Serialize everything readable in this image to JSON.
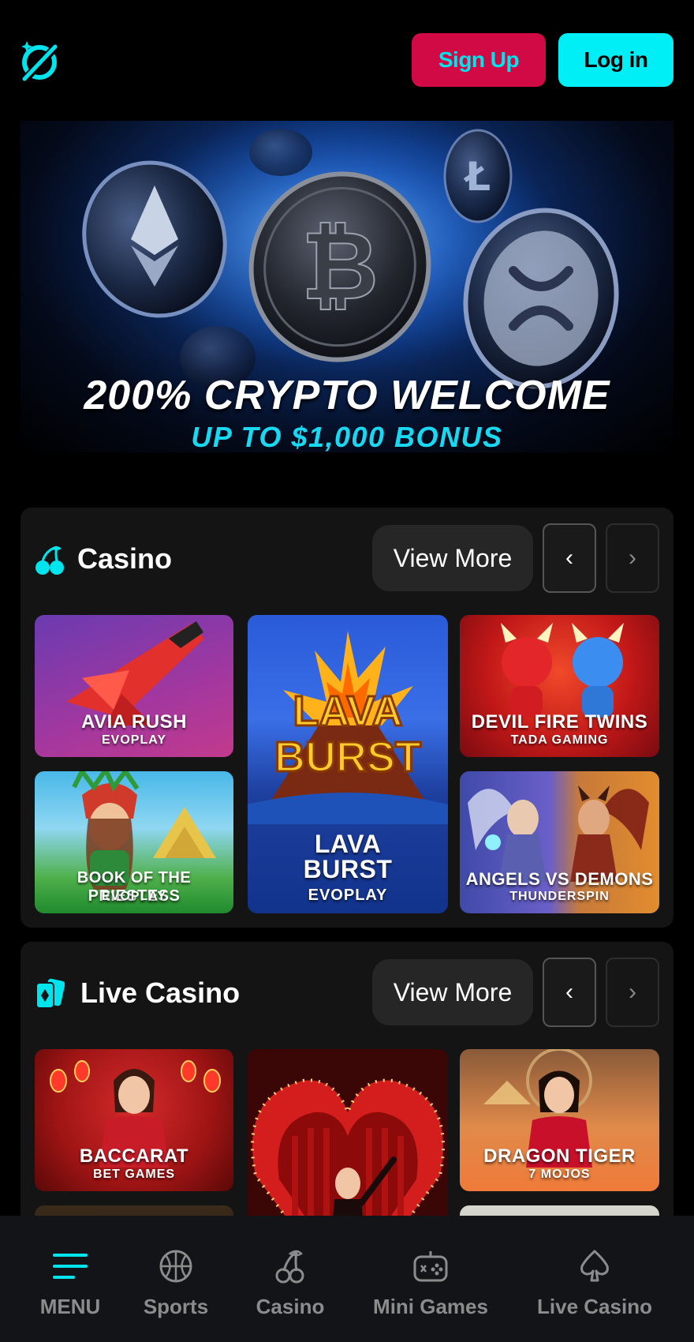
{
  "header": {
    "signup_label": "Sign Up",
    "login_label": "Log in"
  },
  "banner": {
    "line1": "200% CRYPTO WELCOME",
    "line2": "UP TO $1,000 BONUS"
  },
  "casino": {
    "title": "Casino",
    "view_more": "View More",
    "games": [
      {
        "name": "AVIA RUSH",
        "provider": "EVOPLAY"
      },
      {
        "name": "LAVA BURST",
        "name_line1": "LAVA",
        "name_line2": "BURST",
        "provider": "EVOPLAY",
        "logo_line1": "LAVA",
        "logo_line2": "BURST"
      },
      {
        "name": "DEVIL FIRE TWINS",
        "provider": "TADA GAMING"
      },
      {
        "name": "BOOK OF THE PRIESTESS",
        "provider": "EVOPLAY"
      },
      {
        "name": "ANGELS VS DEMONS",
        "provider": "THUNDERSPIN"
      }
    ]
  },
  "live_casino": {
    "title": "Live Casino",
    "view_more": "View More",
    "games": [
      {
        "name": "BACCARAT",
        "provider": "BET GAMES"
      },
      {
        "name": "",
        "provider": ""
      },
      {
        "name": "DRAGON TIGER",
        "provider": "7 MOJOS"
      }
    ]
  },
  "bottom_nav": {
    "items": [
      {
        "label": "MENU",
        "icon": "menu-icon",
        "active": true
      },
      {
        "label": "Sports",
        "icon": "basketball-icon"
      },
      {
        "label": "Casino",
        "icon": "cherry-icon"
      },
      {
        "label": "Mini Games",
        "icon": "gamepad-icon"
      },
      {
        "label": "Live Casino",
        "icon": "spade-icon"
      }
    ]
  },
  "colors": {
    "accent_cyan": "#00eef5",
    "signup_red": "#d10a45",
    "panel": "#141414",
    "nav_bg": "#121417"
  }
}
